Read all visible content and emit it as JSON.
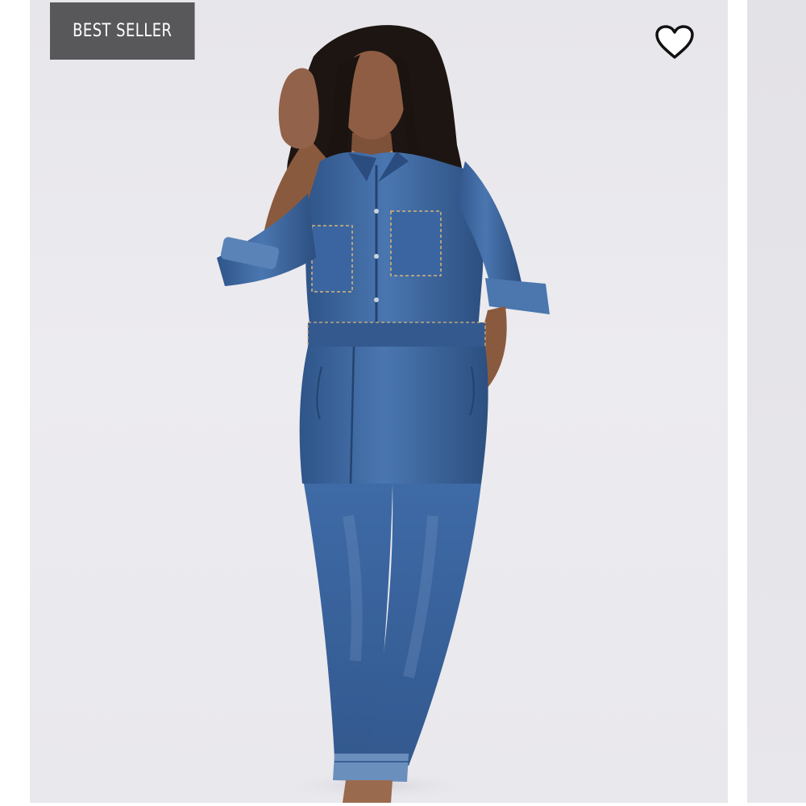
{
  "product_card": {
    "badge_label": "BEST SELLER",
    "wishlist_icon": "heart-outline-icon",
    "image_subject": "",
    "colors": {
      "badge_background": "#58585a",
      "badge_text": "#ffffff",
      "image_background": "#e9e8ec",
      "denim": "#3f6aa3"
    }
  }
}
